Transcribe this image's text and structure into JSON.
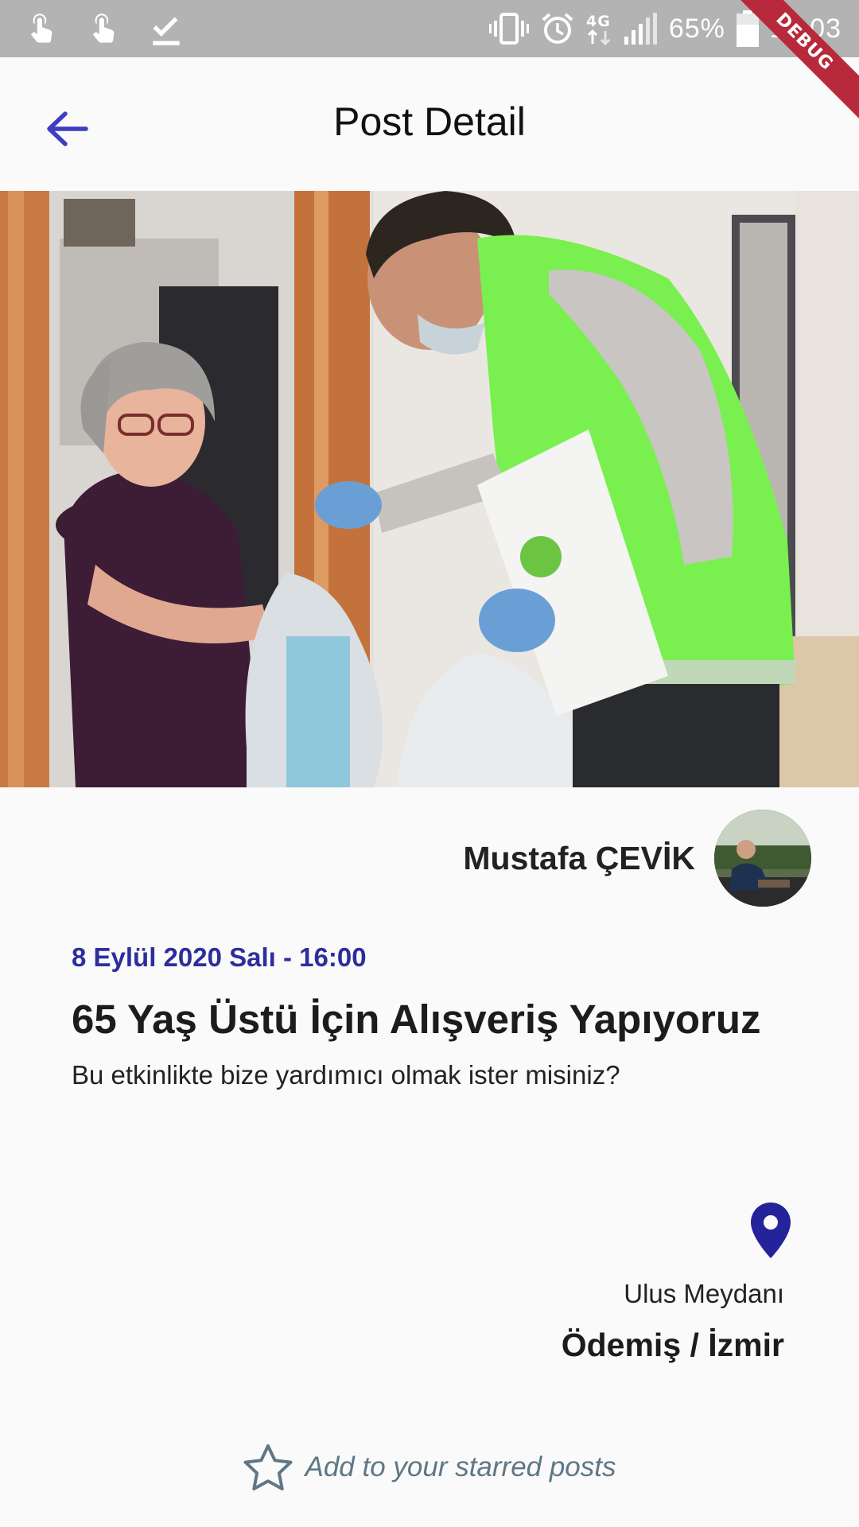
{
  "status_bar": {
    "battery": "65%",
    "time": "17:03",
    "network": "4G",
    "left_icons": [
      "touch-icon",
      "touch-icon",
      "check-icon"
    ],
    "right_icons": [
      "vibrate-icon",
      "alarm-icon",
      "network-4g-icon",
      "signal-icon",
      "battery-icon"
    ]
  },
  "debug_banner": "DEBUG",
  "app_bar": {
    "title": "Post Detail",
    "back_icon": "arrow-back-icon",
    "accent": "#3f3cc4"
  },
  "post": {
    "author": "Mustafa ÇEVİK",
    "date": "8 Eylül 2020 Salı - 16:00",
    "title": "65 Yaş Üstü İçin Alışveriş Yapıyoruz",
    "description": "Bu etkinlikte bize yardımıcı olmak ister misiniz?",
    "location": {
      "icon": "location-pin-icon",
      "place": "Ulus Meydanı",
      "city": "Ödemiş / İzmir"
    },
    "star_action": "Add to your starred posts"
  },
  "colors": {
    "date": "#2d2e9c",
    "pin": "#24239a",
    "star": "#5f7785",
    "status_bar": "#b3b3b3",
    "debug_banner": "#b7293b"
  }
}
